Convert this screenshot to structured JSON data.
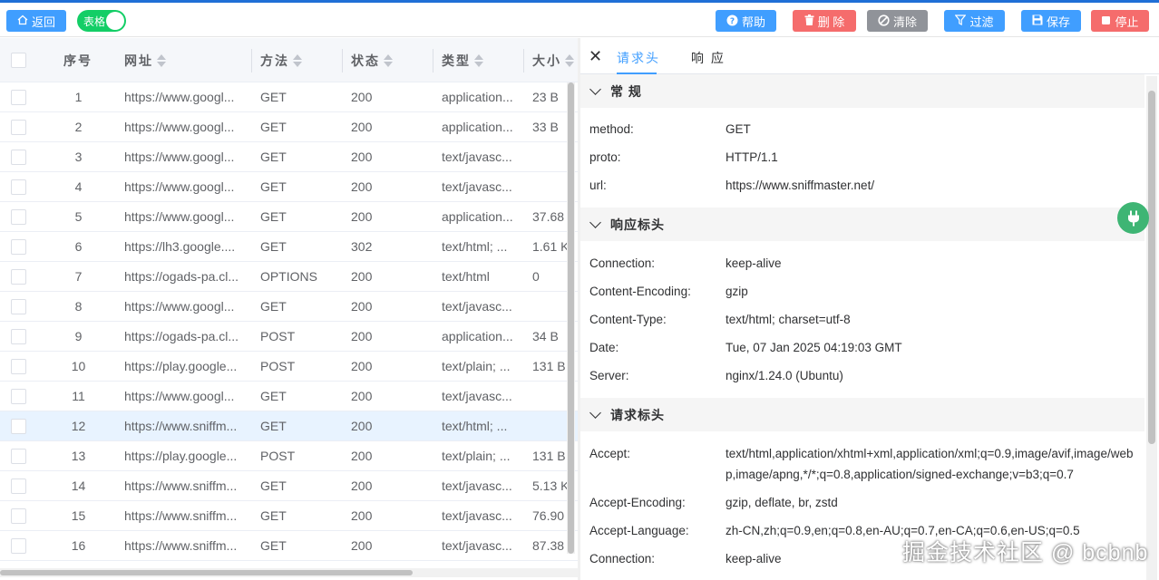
{
  "toolbar": {
    "back_label": "返回",
    "table_switch_label": "表格",
    "help_label": "帮助",
    "delete_label": "删 除",
    "clear_label": "清除",
    "filter_label": "过滤",
    "save_label": "保存",
    "stop_label": "停止"
  },
  "colors": {
    "primary": "#409eff",
    "danger": "#f56c6c",
    "info": "#909399",
    "success": "#13ce66",
    "plug": "#3eb574"
  },
  "table": {
    "headers": {
      "index": "序号",
      "url": "网址",
      "method": "方法",
      "status": "状态",
      "type": "类型",
      "size": "大小"
    },
    "selected_row": 12,
    "rows": [
      {
        "index": "1",
        "url": "https://www.googl...",
        "method": "GET",
        "status": "200",
        "type": "application...",
        "size": "23 B"
      },
      {
        "index": "2",
        "url": "https://www.googl...",
        "method": "GET",
        "status": "200",
        "type": "application...",
        "size": "33 B"
      },
      {
        "index": "3",
        "url": "https://www.googl...",
        "method": "GET",
        "status": "200",
        "type": "text/javasc...",
        "size": ""
      },
      {
        "index": "4",
        "url": "https://www.googl...",
        "method": "GET",
        "status": "200",
        "type": "text/javasc...",
        "size": ""
      },
      {
        "index": "5",
        "url": "https://www.googl...",
        "method": "GET",
        "status": "200",
        "type": "application...",
        "size": "37.68"
      },
      {
        "index": "6",
        "url": "https://lh3.google....",
        "method": "GET",
        "status": "302",
        "type": "text/html; ...",
        "size": "1.61 K"
      },
      {
        "index": "7",
        "url": "https://ogads-pa.cl...",
        "method": "OPTIONS",
        "status": "200",
        "type": "text/html",
        "size": "0"
      },
      {
        "index": "8",
        "url": "https://www.googl...",
        "method": "GET",
        "status": "200",
        "type": "text/javasc...",
        "size": ""
      },
      {
        "index": "9",
        "url": "https://ogads-pa.cl...",
        "method": "POST",
        "status": "200",
        "type": "application...",
        "size": "34 B"
      },
      {
        "index": "10",
        "url": "https://play.google...",
        "method": "POST",
        "status": "200",
        "type": "text/plain; ...",
        "size": "131 B"
      },
      {
        "index": "11",
        "url": "https://www.googl...",
        "method": "GET",
        "status": "200",
        "type": "text/javasc...",
        "size": ""
      },
      {
        "index": "12",
        "url": "https://www.sniffm...",
        "method": "GET",
        "status": "200",
        "type": "text/html; ...",
        "size": ""
      },
      {
        "index": "13",
        "url": "https://play.google...",
        "method": "POST",
        "status": "200",
        "type": "text/plain; ...",
        "size": "131 B"
      },
      {
        "index": "14",
        "url": "https://www.sniffm...",
        "method": "GET",
        "status": "200",
        "type": "text/javasc...",
        "size": "5.13 K"
      },
      {
        "index": "15",
        "url": "https://www.sniffm...",
        "method": "GET",
        "status": "200",
        "type": "text/javasc...",
        "size": "76.90"
      },
      {
        "index": "16",
        "url": "https://www.sniffm...",
        "method": "GET",
        "status": "200",
        "type": "text/javasc...",
        "size": "87.38"
      }
    ]
  },
  "detail": {
    "tabs": {
      "request_headers": "请求头",
      "response": "响 应"
    },
    "sections": {
      "general": {
        "title": "常 规",
        "items": [
          {
            "key": "method:",
            "value": "GET"
          },
          {
            "key": "proto:",
            "value": "HTTP/1.1"
          },
          {
            "key": "url:",
            "value": "https://www.sniffmaster.net/"
          }
        ]
      },
      "response_headers": {
        "title": "响应标头",
        "items": [
          {
            "key": "Connection:",
            "value": "keep-alive"
          },
          {
            "key": "Content-Encoding:",
            "value": "gzip"
          },
          {
            "key": "Content-Type:",
            "value": "text/html; charset=utf-8"
          },
          {
            "key": "Date:",
            "value": "Tue, 07 Jan 2025 04:19:03 GMT"
          },
          {
            "key": "Server:",
            "value": "nginx/1.24.0 (Ubuntu)"
          }
        ]
      },
      "request_headers": {
        "title": "请求标头",
        "items": [
          {
            "key": "Accept:",
            "value": "text/html,application/xhtml+xml,application/xml;q=0.9,image/avif,image/webp,image/apng,*/*;q=0.8,application/signed-exchange;v=b3;q=0.7"
          },
          {
            "key": "Accept-Encoding:",
            "value": "gzip, deflate, br, zstd"
          },
          {
            "key": "Accept-Language:",
            "value": "zh-CN,zh;q=0.9,en;q=0.8,en-AU;q=0.7,en-CA;q=0.6,en-US;q=0.5"
          },
          {
            "key": "Connection:",
            "value": "keep-alive"
          }
        ]
      }
    }
  },
  "watermark": "掘金技术社区 @ bcbnb"
}
